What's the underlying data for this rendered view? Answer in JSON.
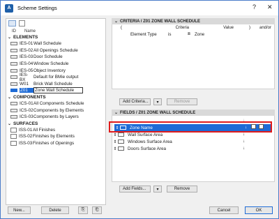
{
  "window": {
    "title": "Scheme Settings"
  },
  "left": {
    "columns": {
      "id": "ID",
      "name": "Name"
    },
    "groups": [
      {
        "label": "ELEMENTS",
        "items": [
          {
            "id": "IES-01",
            "name": "Wall Schedule"
          },
          {
            "id": "IES-02",
            "name": "All Openings Schedule"
          },
          {
            "id": "IES-03",
            "name": "Door Schedule"
          },
          {
            "id": "IES-04",
            "name": "Window Schedule"
          },
          {
            "id": "IES-05",
            "name": "Object Inventory"
          },
          {
            "id": "IES-BX",
            "name": "Default for BMie output"
          },
          {
            "id": "W01",
            "name": "Brick Wall Schedule"
          },
          {
            "id": "Z01",
            "name": "Zone Wall Schedule"
          }
        ]
      },
      {
        "label": "COMPONENTS",
        "items": [
          {
            "id": "ICS-01",
            "name": "All Components Schedule"
          },
          {
            "id": "ICS-02",
            "name": "Components by Elements"
          },
          {
            "id": "ICS-03",
            "name": "Components by Layers"
          }
        ]
      },
      {
        "label": "SURFACES",
        "items": [
          {
            "id": "ISS-01",
            "name": "All Finishes"
          },
          {
            "id": "ISS-02",
            "name": "Finishes by Elements"
          },
          {
            "id": "ISS-03",
            "name": "Finishes of Openings"
          }
        ]
      }
    ],
    "buttons": {
      "new": "New...",
      "delete": "Delete"
    }
  },
  "criteria": {
    "header": "CRITERIA / Z01 ZONE WALL SCHEDULE",
    "columns": {
      "open": "(",
      "criteria": "Criteria",
      "value": "Value",
      "close": ")",
      "andor": "and/or"
    },
    "row": {
      "criteria": "Element Type",
      "op": "is",
      "value": "Zone"
    },
    "add_button": "Add Criteria...",
    "remove_button": "Remove"
  },
  "fields": {
    "header": "FIELDS / Z01 ZONE WALL SCHEDULE",
    "rows": [
      {
        "label": "Zone Name",
        "selected": true
      },
      {
        "label": "Wall Surface Area",
        "selected": false
      },
      {
        "label": "Windows Surface Area",
        "selected": false
      },
      {
        "label": "Doors Surface Area",
        "selected": false
      }
    ],
    "add_button": "Add Fields...",
    "remove_button": "Remove"
  },
  "dialog_buttons": {
    "cancel": "Cancel",
    "ok": "OK"
  },
  "colors": {
    "selection": "#1e6bd6",
    "highlight_box": "#e01b1b"
  }
}
